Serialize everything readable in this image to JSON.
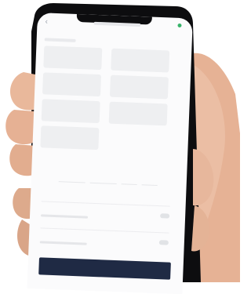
{
  "scene": {
    "description_free": true,
    "colors": {
      "skin": "#e7b79c",
      "skin_shadow": "#c98f72",
      "phone_frame": "#0d0d0f",
      "screen_bg": "#fbfbfc",
      "cta": "#1f2a44",
      "accent_dot": "#38b36a"
    },
    "icons": [
      "back-arrow-icon",
      "signal-dot-icon"
    ]
  },
  "screen": {
    "categories": [
      "",
      "",
      "",
      "",
      "",
      "",
      ""
    ],
    "times": [
      "",
      "",
      "",
      ""
    ],
    "settings": [
      {
        "title": ""
      },
      {
        "title": ""
      }
    ],
    "cta_label": ""
  }
}
